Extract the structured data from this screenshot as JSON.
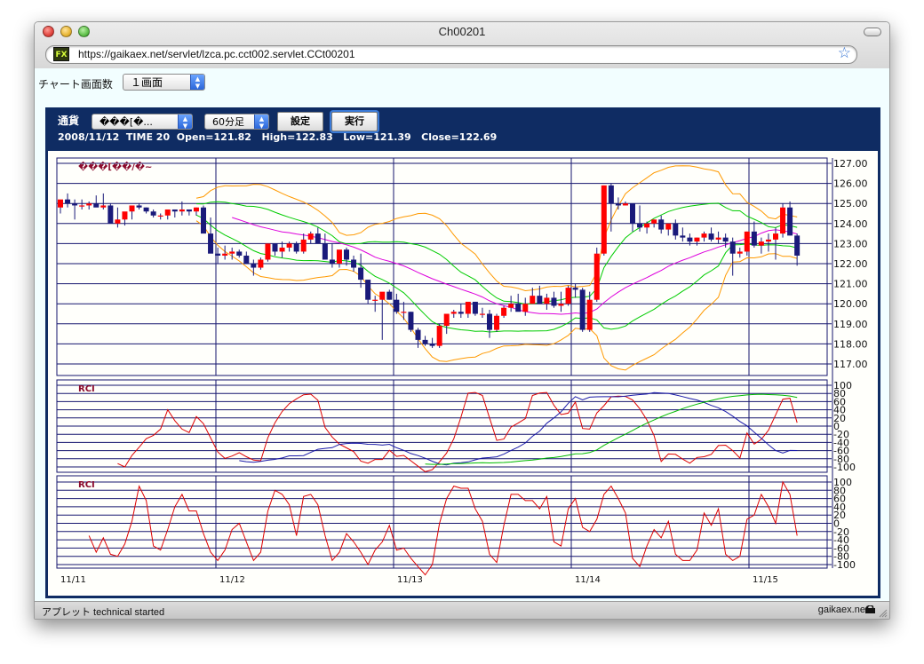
{
  "window": {
    "title": "Ch00201",
    "url": "https://gaikaex.net/servlet/lzca.pc.cct002.servlet.CCt00201",
    "status_left": "アプレット technical started",
    "status_right": "gaikaex.net",
    "favicon_text": "FX"
  },
  "controls": {
    "screen_count_label": "チャート画面数",
    "screen_count_value": "１画面",
    "currency_label": "通貨",
    "currency_value": "���[�...",
    "period_value": "60分足",
    "settings_button": "設定",
    "run_button": "実行"
  },
  "info_line": "2008/11/12  TIME 20  Open=121.82   High=122.83   Low=121.39   Close=122.69",
  "colors": {
    "panel_bg": "#0f2c63",
    "grid": "#16166e",
    "up_candle": "#ff0000",
    "down_candle": "#1a1a7a",
    "band_outer": "#ff9900",
    "band_inner": "#00cc00",
    "ma": "#dd00dd",
    "rci_short": "#dd0000",
    "rci_mid": "#1a1aaa",
    "rci_long": "#00bb00"
  },
  "chart_data": [
    {
      "type": "candlestick",
      "title": "���[��/�~",
      "y_ticks": [
        "127.00",
        "126.00",
        "125.00",
        "124.00",
        "123.00",
        "122.00",
        "121.00",
        "120.00",
        "119.00",
        "118.00",
        "117.00"
      ],
      "ylim": [
        116.7,
        127.3
      ],
      "x_labels": [
        "11/11",
        "11/12",
        "11/13",
        "11/14",
        "11/15"
      ],
      "opens": [
        124.8,
        125.2,
        125.0,
        124.9,
        124.9,
        125.0,
        124.8,
        124.9,
        124.0,
        124.2,
        124.6,
        124.9,
        124.8,
        124.6,
        124.4,
        124.4,
        124.7,
        124.6,
        124.7,
        124.6,
        124.8,
        123.5,
        122.5,
        122.4,
        122.5,
        122.6,
        122.4,
        122.0,
        121.8,
        122.2,
        123.0,
        122.6,
        122.8,
        123.0,
        122.6,
        123.2,
        123.5,
        123.0,
        122.2,
        122.0,
        122.7,
        122.2,
        121.8,
        121.2,
        120.2,
        120.2,
        120.6,
        120.2,
        119.6,
        119.6,
        118.7,
        118.2,
        118.0,
        117.9,
        118.9,
        119.5,
        119.6,
        119.5,
        120.1,
        119.5,
        119.5,
        118.7,
        119.4,
        119.8,
        120.0,
        119.6,
        120.0,
        120.4,
        120.0,
        120.3,
        119.9,
        120.0,
        120.8,
        120.7,
        118.7,
        120.2,
        122.5,
        125.9,
        125.0,
        124.9,
        125.0,
        124.0,
        123.8,
        124.0,
        124.2,
        123.7,
        124.0,
        123.4,
        123.3,
        123.1,
        123.3,
        123.5,
        123.2,
        123.3,
        123.1,
        122.5,
        122.6,
        123.6,
        122.9,
        123.1,
        123.2,
        123.5,
        124.8,
        123.4
      ],
      "highs": [
        125.0,
        125.5,
        125.2,
        125.2,
        125.1,
        125.4,
        125.5,
        125.0,
        124.8,
        124.4,
        124.9,
        125.0,
        124.8,
        124.7,
        124.5,
        124.5,
        124.7,
        125.1,
        124.7,
        124.8,
        124.9,
        124.3,
        122.8,
        122.9,
        122.8,
        122.7,
        122.6,
        122.2,
        122.3,
        122.8,
        123.0,
        123.1,
        123.1,
        123.1,
        123.5,
        123.6,
        123.8,
        123.5,
        123.0,
        122.3,
        122.8,
        122.4,
        122.5,
        121.2,
        120.4,
        120.4,
        120.7,
        120.5,
        120.1,
        119.6,
        118.8,
        118.4,
        118.3,
        119.0,
        119.5,
        119.7,
        120.0,
        120.0,
        120.1,
        119.8,
        119.7,
        119.5,
        119.9,
        120.4,
        120.5,
        120.3,
        120.8,
        120.9,
        120.5,
        120.6,
        120.6,
        120.9,
        121.0,
        120.8,
        120.6,
        122.8,
        125.9,
        126.0,
        125.3,
        125.1,
        125.0,
        124.9,
        124.1,
        124.2,
        124.4,
        124.0,
        124.2,
        123.8,
        123.5,
        123.3,
        123.6,
        123.8,
        123.6,
        123.5,
        123.3,
        122.8,
        123.6,
        124.1,
        123.3,
        123.5,
        123.8,
        125.0,
        125.1,
        123.5
      ],
      "lows": [
        124.5,
        124.8,
        124.2,
        124.7,
        124.7,
        124.9,
        124.7,
        124.0,
        123.8,
        123.9,
        124.2,
        124.7,
        124.5,
        124.3,
        124.2,
        124.2,
        124.3,
        124.4,
        124.4,
        124.4,
        124.6,
        123.3,
        122.0,
        122.2,
        122.2,
        122.3,
        122.1,
        121.4,
        121.7,
        122.1,
        122.4,
        122.3,
        122.6,
        122.5,
        122.5,
        123.0,
        123.2,
        122.3,
        121.8,
        121.8,
        121.9,
        121.6,
        120.8,
        120.0,
        119.6,
        118.2,
        120.2,
        119.5,
        119.2,
        118.6,
        117.8,
        117.9,
        117.8,
        117.8,
        118.5,
        119.3,
        119.3,
        119.3,
        119.4,
        119.3,
        118.3,
        118.6,
        119.3,
        119.6,
        119.7,
        119.4,
        120.0,
        120.1,
        119.7,
        119.8,
        119.6,
        119.9,
        120.3,
        118.6,
        118.6,
        120.1,
        122.4,
        123.6,
        124.7,
        124.9,
        123.6,
        123.6,
        123.5,
        123.8,
        123.5,
        123.4,
        123.2,
        123.1,
        122.9,
        122.9,
        123.1,
        123.1,
        123.0,
        122.8,
        121.4,
        122.3,
        122.4,
        122.8,
        122.5,
        122.6,
        122.2,
        123.3,
        123.4,
        121.9
      ],
      "closes": [
        125.2,
        125.0,
        124.9,
        124.9,
        125.0,
        124.8,
        124.9,
        124.0,
        124.2,
        124.6,
        124.9,
        124.8,
        124.6,
        124.4,
        124.4,
        124.7,
        124.6,
        124.7,
        124.6,
        124.8,
        123.5,
        122.5,
        122.4,
        122.5,
        122.6,
        122.4,
        122.0,
        121.8,
        122.2,
        123.0,
        122.6,
        122.8,
        123.0,
        122.6,
        123.2,
        123.5,
        123.0,
        122.2,
        122.0,
        122.7,
        122.2,
        121.8,
        121.2,
        120.2,
        120.2,
        120.6,
        120.2,
        119.6,
        119.6,
        118.7,
        118.2,
        118.0,
        117.9,
        118.9,
        119.5,
        119.6,
        119.5,
        120.1,
        119.5,
        119.5,
        118.7,
        119.4,
        119.8,
        120.0,
        119.6,
        120.0,
        120.4,
        120.0,
        120.3,
        119.9,
        120.0,
        120.8,
        120.7,
        118.7,
        120.2,
        122.5,
        125.9,
        125.0,
        124.9,
        125.0,
        124.0,
        123.8,
        124.0,
        124.2,
        123.7,
        124.0,
        123.4,
        123.3,
        123.1,
        123.3,
        123.5,
        123.2,
        123.3,
        123.1,
        122.5,
        122.6,
        123.6,
        122.9,
        123.1,
        123.2,
        123.5,
        124.8,
        123.4,
        122.4
      ]
    },
    {
      "type": "line",
      "title": "RCI",
      "y_ticks": [
        "100",
        "80",
        "60",
        "40",
        "20",
        "0",
        "-20",
        "-40",
        "-60",
        "-80",
        "-100"
      ],
      "ylim": [
        -100,
        100
      ],
      "x_labels": [
        "11/11",
        "11/12",
        "11/13",
        "11/14",
        "11/15"
      ]
    },
    {
      "type": "line",
      "title": "RCI",
      "y_ticks": [
        "100",
        "80",
        "60",
        "40",
        "20",
        "0",
        "-20",
        "-40",
        "-60",
        "-80",
        "-100"
      ],
      "ylim": [
        -100,
        100
      ],
      "x_labels": [
        "11/11",
        "11/12",
        "11/13",
        "11/14",
        "11/15"
      ]
    }
  ]
}
